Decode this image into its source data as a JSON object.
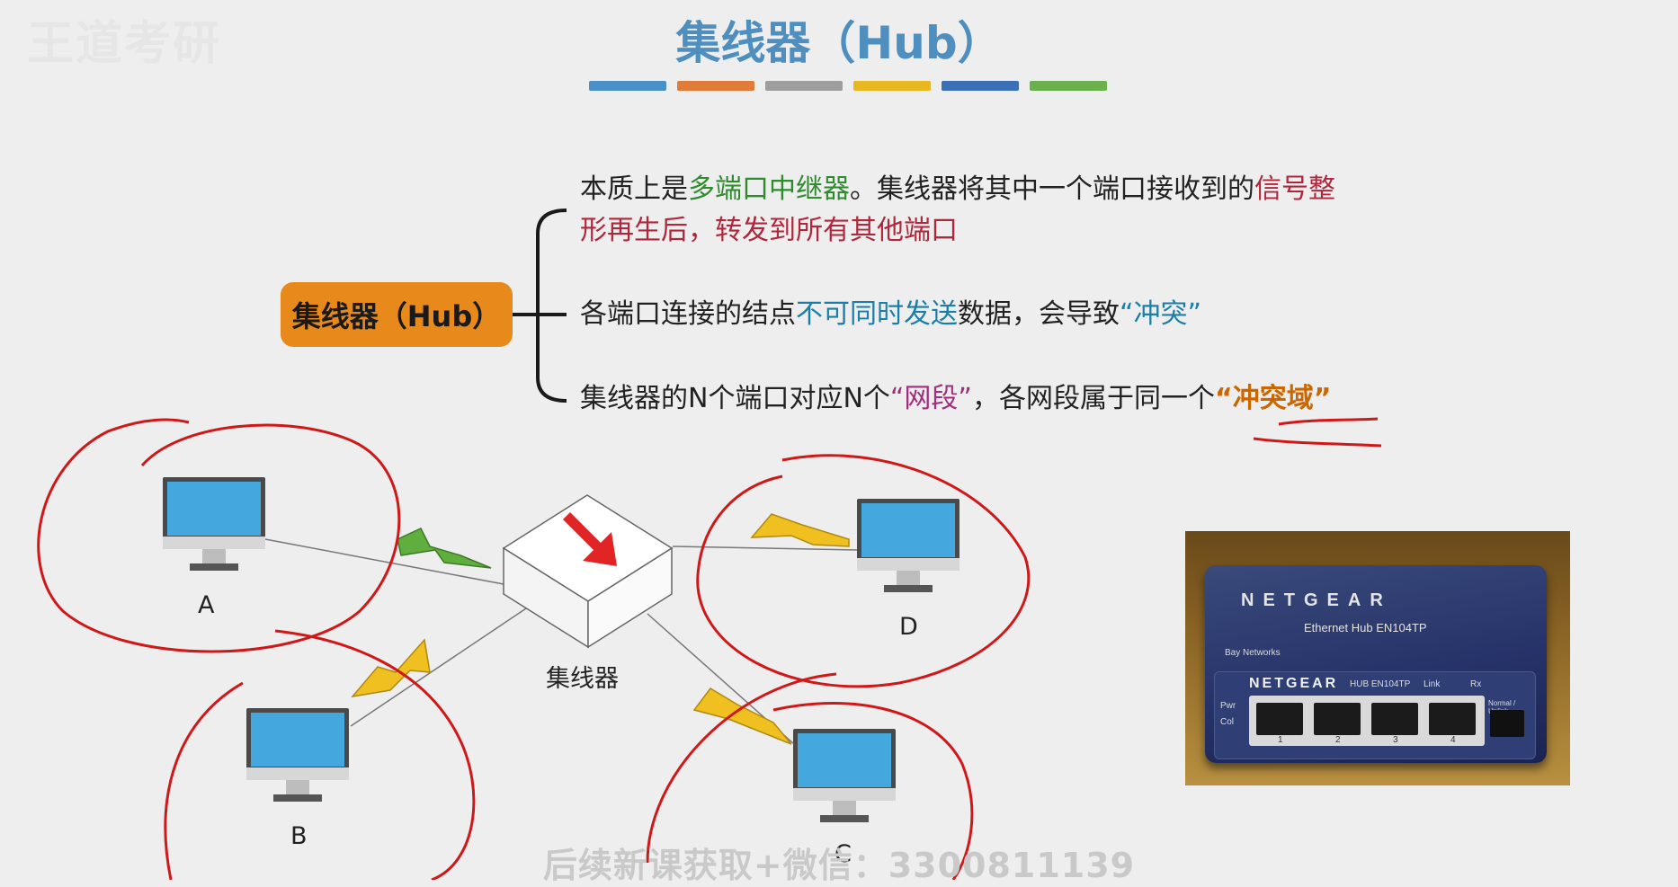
{
  "watermark_top_left": "王道考研",
  "title": "集线器（Hub）",
  "color_bar": [
    "#4a90c8",
    "#e07b39",
    "#9e9e9e",
    "#e8b820",
    "#3b6fb6",
    "#6ab04c"
  ],
  "hub_box_label": "集线器（Hub）",
  "bullet1": {
    "part1": "本质上是",
    "part2": "多端口中继器",
    "part3": "。集线器将其中一个端口接收到的",
    "part4": "信号整",
    "line2": "形再生后，转发到所有其他端口"
  },
  "bullet2": {
    "part1": "各端口连接的结点",
    "part2": "不可同时发送",
    "part3": "数据，会导致",
    "part4": "“冲突”"
  },
  "bullet3": {
    "part1": "集线器的N个端口对应N个",
    "part2": "“网段”",
    "part3": "，各网段属于同一个",
    "part4": "“冲突域”"
  },
  "diagram": {
    "hub_label": "集线器",
    "computers": [
      "A",
      "B",
      "C",
      "D"
    ]
  },
  "photo": {
    "brand": "NETGEAR",
    "model_text": "Ethernet Hub EN104TP",
    "sub_brand": "Bay Networks",
    "front_brand": "NETGEAR",
    "front_model": "HUB EN104TP",
    "indicators": [
      "Pwr",
      "Col"
    ],
    "link_label": "Link",
    "rx_label": "Rx",
    "uplink_label": "Normal / Uplink",
    "port_numbers": [
      "1",
      "2",
      "3",
      "4"
    ]
  },
  "footer": "后续新课获取+微信：3300811139"
}
